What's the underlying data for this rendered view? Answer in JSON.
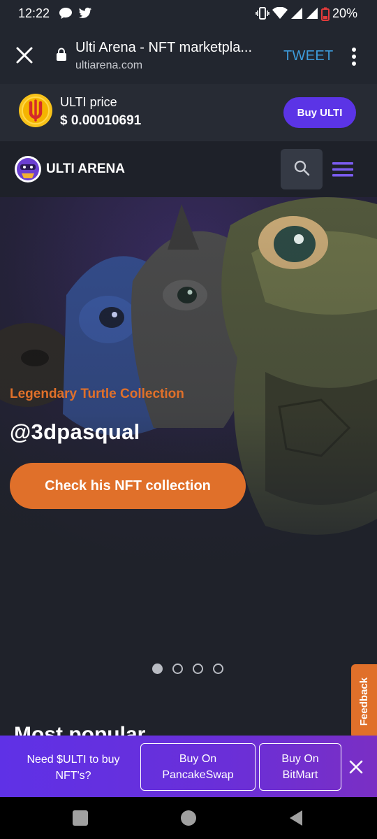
{
  "status_bar": {
    "time": "12:22",
    "battery": "20%",
    "icons": [
      "chat-bubble-icon",
      "twitter-icon",
      "vibrate-icon",
      "wifi-icon",
      "signal-icon",
      "signal-icon",
      "battery-low-icon"
    ]
  },
  "browser": {
    "page_title": "Ulti Arena - NFT marketpla...",
    "url": "ultiarena.com",
    "tweet_label": "TWEET"
  },
  "price_bar": {
    "label": "ULTI price",
    "value": "$ 0.00010691",
    "buy_label": "Buy ULTI",
    "accent": "#5b34e6"
  },
  "header": {
    "brand": "ULTI ARENA"
  },
  "hero": {
    "kicker": "Legendary Turtle Collection",
    "title": "@3dpasqual",
    "cta_label": "Check his NFT collection",
    "accent": "#e0702a",
    "slides": 4,
    "active_slide": 1
  },
  "section_peek": "Most popular",
  "feedback_label": "Feedback",
  "promo": {
    "text": "Need $ULTI to buy NFT's?",
    "pancake_label": "Buy On PancakeSwap",
    "bitmart_label": "Buy On BitMart"
  }
}
